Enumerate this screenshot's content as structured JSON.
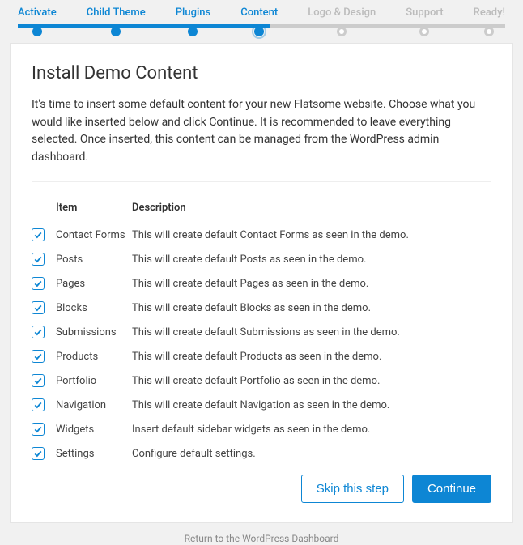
{
  "stepper": {
    "steps": [
      {
        "label": "Activate",
        "state": "done"
      },
      {
        "label": "Child Theme",
        "state": "done"
      },
      {
        "label": "Plugins",
        "state": "done"
      },
      {
        "label": "Content",
        "state": "current"
      },
      {
        "label": "Logo & Design",
        "state": "pending"
      },
      {
        "label": "Support",
        "state": "pending"
      },
      {
        "label": "Ready!",
        "state": "pending"
      }
    ]
  },
  "page": {
    "title": "Install Demo Content",
    "intro": "It's time to insert some default content for your new Flatsome website. Choose what you would like inserted below and click Continue. It is recommended to leave everything selected. Once inserted, this content can be managed from the WordPress admin dashboard."
  },
  "table": {
    "headers": {
      "item": "Item",
      "description": "Description"
    },
    "rows": [
      {
        "checked": true,
        "item": "Contact Forms",
        "description": "This will create default Contact Forms as seen in the demo."
      },
      {
        "checked": true,
        "item": "Posts",
        "description": "This will create default Posts as seen in the demo."
      },
      {
        "checked": true,
        "item": "Pages",
        "description": "This will create default Pages as seen in the demo."
      },
      {
        "checked": true,
        "item": "Blocks",
        "description": "This will create default Blocks as seen in the demo."
      },
      {
        "checked": true,
        "item": "Submissions",
        "description": "This will create default Submissions as seen in the demo."
      },
      {
        "checked": true,
        "item": "Products",
        "description": "This will create default Products as seen in the demo."
      },
      {
        "checked": true,
        "item": "Portfolio",
        "description": "This will create default Portfolio as seen in the demo."
      },
      {
        "checked": true,
        "item": "Navigation",
        "description": "This will create default Navigation as seen in the demo."
      },
      {
        "checked": true,
        "item": "Widgets",
        "description": "Insert default sidebar widgets as seen in the demo."
      },
      {
        "checked": true,
        "item": "Settings",
        "description": "Configure default settings."
      }
    ]
  },
  "actions": {
    "skip": "Skip this step",
    "continue": "Continue"
  },
  "footer": {
    "link": "Return to the WordPress Dashboard"
  }
}
